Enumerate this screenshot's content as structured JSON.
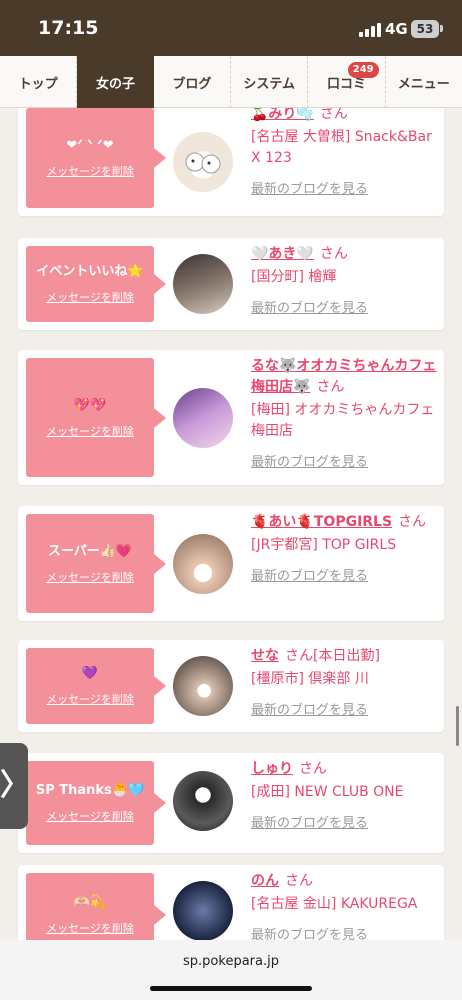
{
  "status_bar": {
    "time": "17:15",
    "network": "4G",
    "battery": "53"
  },
  "nav": {
    "tabs": [
      {
        "label": "トップ"
      },
      {
        "label": "女の子"
      },
      {
        "label": "ブログ"
      },
      {
        "label": "システム"
      },
      {
        "label": "口コミ",
        "badge": "249"
      },
      {
        "label": "メニュー"
      }
    ],
    "active_tab": "女の子"
  },
  "messages": [
    {
      "message": "❤︎ᐟ ᐠ ᐟ❤︎",
      "delete_label": "メッセージを削除",
      "name": "🍒みり🫧",
      "san": "さん",
      "extra": "",
      "shop": "[名古屋 大曽根] Snack&Bar X 123",
      "blog_link": "最新のブログを見る"
    },
    {
      "message": "イベントいいね🌟",
      "delete_label": "メッセージを削除",
      "name": "🤍あき🤍",
      "san": "さん",
      "extra": "",
      "shop": "[国分町] 檜輝",
      "blog_link": "最新のブログを見る"
    },
    {
      "message": "💖💖",
      "delete_label": "メッセージを削除",
      "name": "るな🐺オオカミちゃんカフェ梅田店🐺",
      "san": "さん",
      "extra": "",
      "shop": "[梅田] オオカミちゃんカフェ梅田店",
      "blog_link": "最新のブログを見る"
    },
    {
      "message": "スーパー👍🏻💗",
      "delete_label": "メッセージを削除",
      "name": "🫀あい🫀TOPGIRLS",
      "san": "さん",
      "extra": "",
      "shop": "[JR宇都宮] TOP GIRLS",
      "blog_link": "最新のブログを見る"
    },
    {
      "message": "💜",
      "delete_label": "メッセージを削除",
      "name": "せな",
      "san": "さん",
      "extra": "[本日出勤]",
      "shop": "[橿原市] 倶楽部 川",
      "blog_link": "最新のブログを見る"
    },
    {
      "message": "SP Thanks🐣🩵",
      "delete_label": "メッセージを削除",
      "name": "しゅり",
      "san": "さん",
      "extra": "",
      "shop": "[成田] NEW CLUB ONE",
      "blog_link": "最新のブログを見る"
    },
    {
      "message": "🫶🏻💫",
      "delete_label": "メッセージを削除",
      "name": "のん",
      "san": "さん",
      "extra": "",
      "shop": "[名古屋 金山] KAKUREGA",
      "blog_link": "最新のブログを見る"
    }
  ],
  "side_tab": {
    "label": "〉"
  },
  "url_bar": {
    "url": "sp.pokepara.jp"
  },
  "colors": {
    "header_brown": "#4a3a2a",
    "accent_pink": "#e8486e",
    "message_pink": "#f3909a",
    "badge_red": "#e04545"
  }
}
